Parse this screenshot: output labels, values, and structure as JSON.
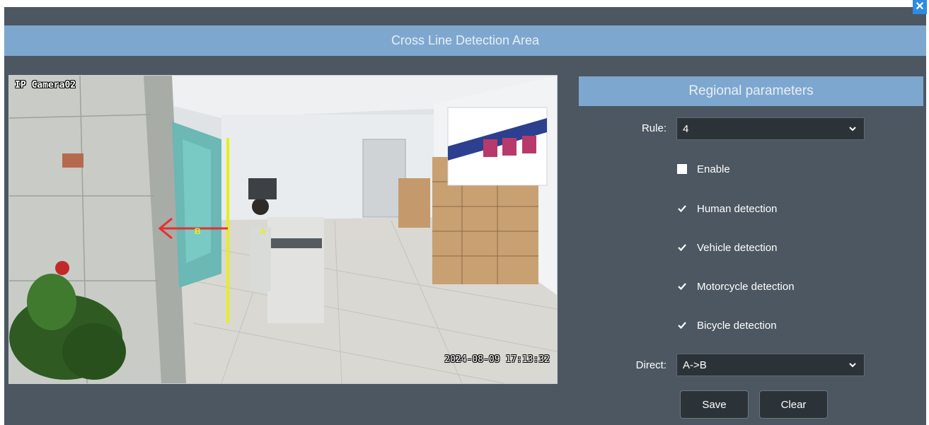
{
  "dialog": {
    "title": "Cross Line Detection Area",
    "close_icon": "close-icon"
  },
  "camera": {
    "name": "IP Camera02",
    "timestamp": "2024-08-09 17:13:32",
    "line_label_a": "A",
    "line_label_b": "B",
    "line_color": "#e6ef1a",
    "arrow_color": "#e53030"
  },
  "panel": {
    "header": "Regional parameters",
    "rule_label": "Rule:",
    "rule_value": "4",
    "checkboxes": [
      {
        "label": "Enable",
        "checked": false
      },
      {
        "label": "Human detection",
        "checked": true
      },
      {
        "label": "Vehicle detection",
        "checked": true
      },
      {
        "label": "Motorcycle detection",
        "checked": true
      },
      {
        "label": "Bicycle detection",
        "checked": true
      }
    ],
    "direct_label": "Direct:",
    "direct_value": "A->B",
    "save_label": "Save",
    "clear_label": "Clear"
  },
  "colors": {
    "background": "#4c5761",
    "title_bar": "#7ea7cf",
    "control_bg": "#2c3338",
    "close_button": "#2f8be0"
  }
}
